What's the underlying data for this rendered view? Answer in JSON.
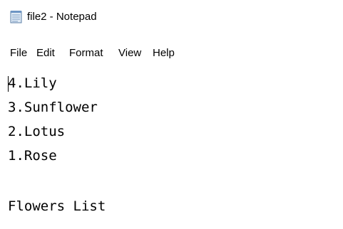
{
  "window": {
    "title": "file2 - Notepad"
  },
  "menu": {
    "file": "File",
    "edit": "Edit",
    "format": "Format",
    "view": "View",
    "help": "Help"
  },
  "editor": {
    "lines": [
      "4.Lily",
      "3.Sunflower",
      "2.Lotus",
      "1.Rose",
      "",
      "Flowers List"
    ]
  },
  "icons": {
    "app": "notepad-icon"
  }
}
